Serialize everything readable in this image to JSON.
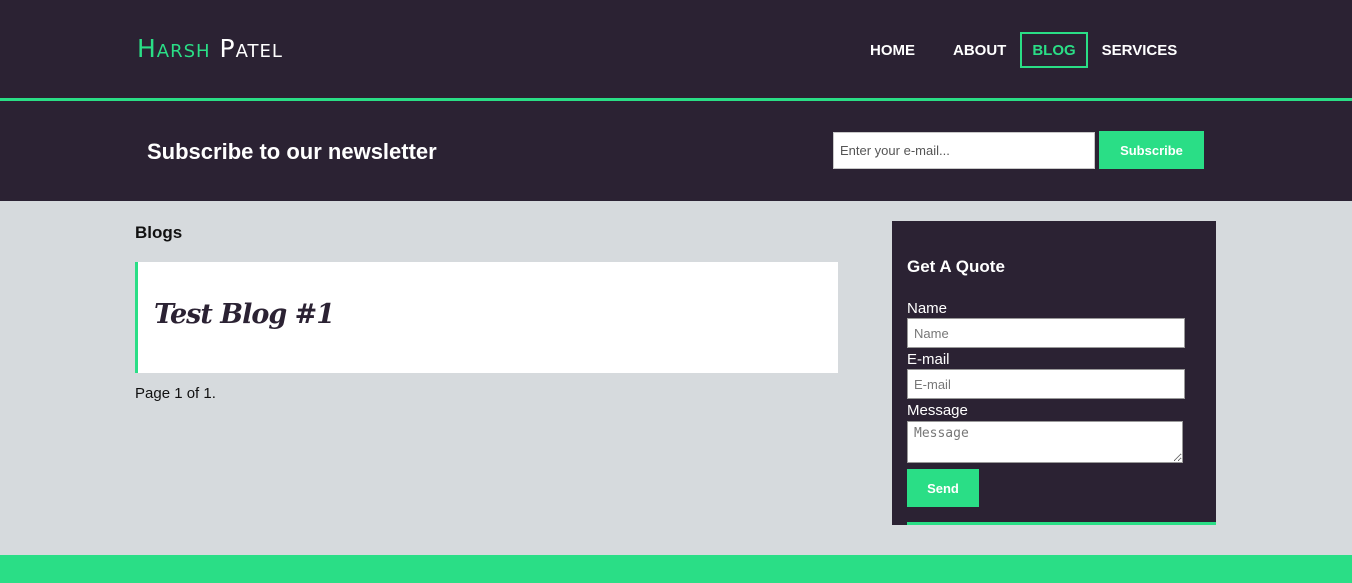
{
  "header": {
    "logo_first": "Harsh",
    "logo_last": "Patel",
    "nav": [
      {
        "label": "HOME",
        "active": false
      },
      {
        "label": "ABOUT",
        "active": false
      },
      {
        "label": "BLOG",
        "active": true
      },
      {
        "label": "SERVICES",
        "active": false
      }
    ]
  },
  "newsletter": {
    "title": "Subscribe to our newsletter",
    "email_placeholder": "Enter your e-mail...",
    "subscribe_label": "Subscribe"
  },
  "main": {
    "heading": "Blogs",
    "posts": [
      {
        "title": "Test Blog #1"
      }
    ],
    "pagination": "Page 1 of 1."
  },
  "quote": {
    "title": "Get A Quote",
    "name_label": "Name",
    "name_placeholder": "Name",
    "email_label": "E-mail",
    "email_placeholder": "E-mail",
    "message_label": "Message",
    "message_placeholder": "Message",
    "send_label": "Send"
  },
  "colors": {
    "accent": "#2ade86",
    "dark": "#2b2233",
    "page_bg": "#d6dadd"
  }
}
